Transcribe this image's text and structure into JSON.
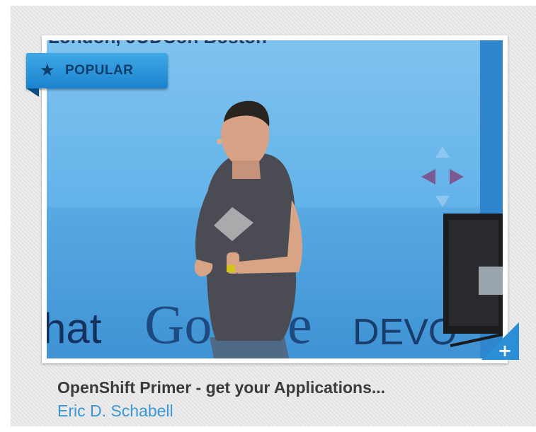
{
  "card": {
    "badge": {
      "icon": "star-icon",
      "label": "POPULAR"
    },
    "thumbnail": {
      "banner_text": "London, JUDCon Boston",
      "logo_texts": [
        "hat",
        "Go",
        "e",
        "DEVO"
      ]
    },
    "expand_button": {
      "icon": "plus-icon",
      "glyph": "+"
    },
    "title": "OpenShift Primer - get your Applications...",
    "author": "Eric D. Schabell"
  },
  "colors": {
    "accent": "#2a8fd6",
    "badge_text": "#0e3f6b",
    "title_text": "#3b3b3b",
    "author_link": "#3a98d6"
  }
}
